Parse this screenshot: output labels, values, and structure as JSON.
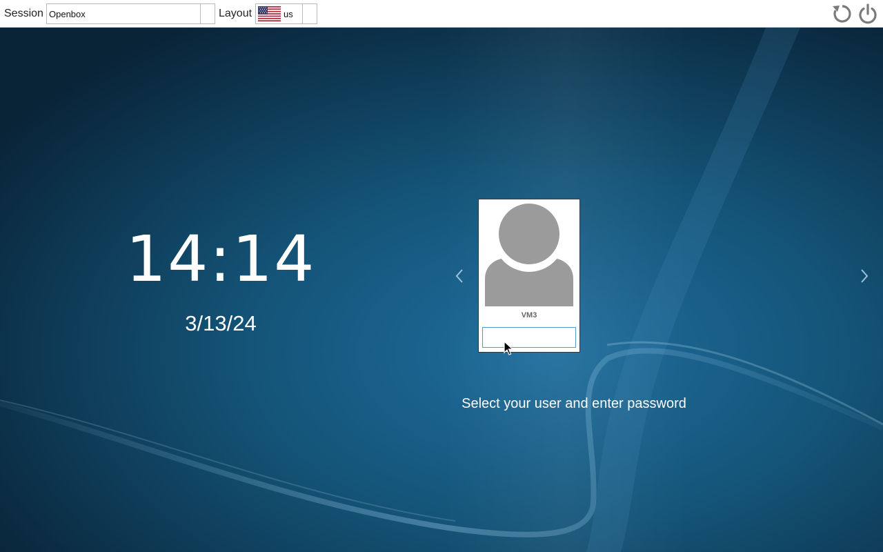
{
  "topbar": {
    "session_label": "Session",
    "session_value": "Openbox",
    "layout_label": "Layout",
    "layout_value": "us",
    "layout_flag": "us-flag-icon",
    "restart_icon": "restart-icon",
    "power_icon": "power-icon"
  },
  "clock": {
    "time": "14:14",
    "date": "3/13/24"
  },
  "user": {
    "name": "VM3",
    "password_value": "",
    "avatar_icon": "user-avatar-icon"
  },
  "navigation": {
    "prev_icon": "chevron-left-icon",
    "next_icon": "chevron-right-icon"
  },
  "hint_text": "Select your user and enter password",
  "colors": {
    "background_dark": "#0b2a40",
    "background_light": "#1f6e9e",
    "card_border": "#2a3a48",
    "focus_border": "#4a9ed0",
    "avatar_gray": "#9b9b9b"
  }
}
